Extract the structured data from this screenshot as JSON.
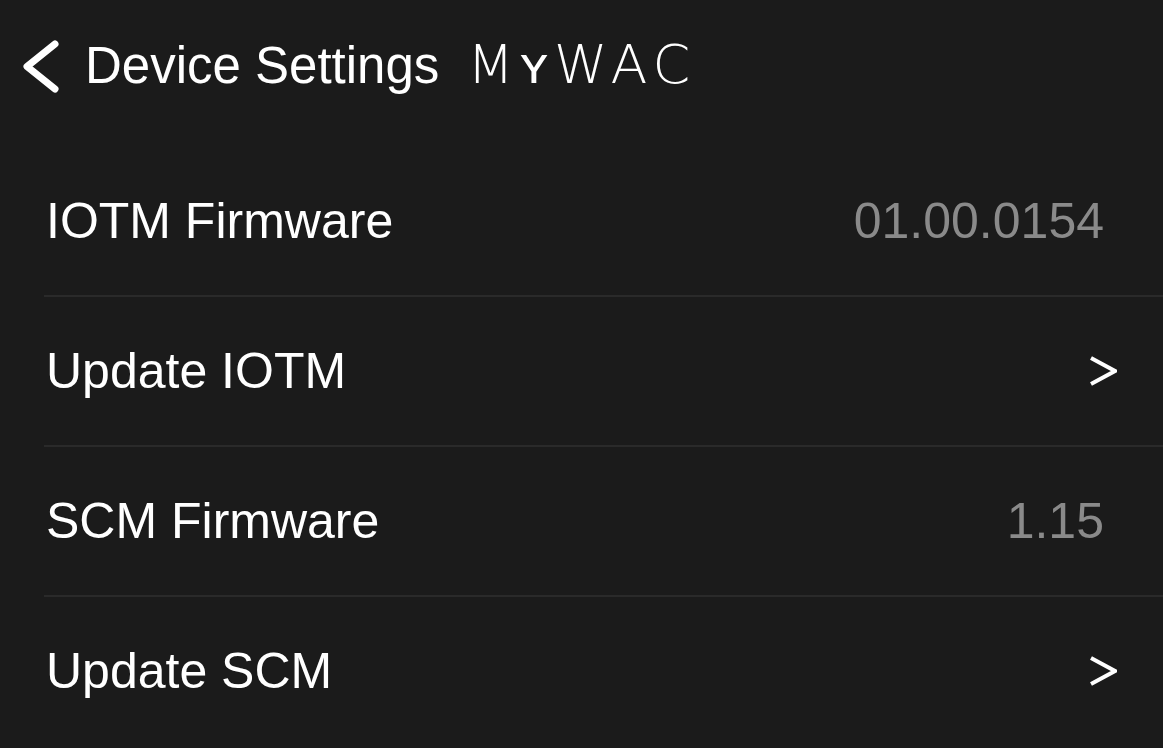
{
  "header": {
    "back_label": "Device Settings",
    "logo": "MʏWAC"
  },
  "rows": [
    {
      "kind": "value",
      "label": "IOTM Firmware",
      "value": "01.00.0154"
    },
    {
      "kind": "link",
      "label": "Update IOTM"
    },
    {
      "kind": "value",
      "label": "SCM Firmware",
      "value": "1.15"
    },
    {
      "kind": "link",
      "label": "Update SCM"
    }
  ]
}
